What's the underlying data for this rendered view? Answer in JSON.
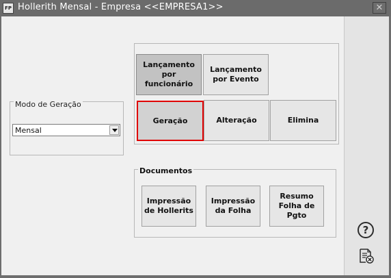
{
  "window": {
    "title": "Hollerith Mensal - Empresa <<EMPRESA1>>",
    "app_icon_text": "FP",
    "close_glyph": "✕"
  },
  "modo_geracao": {
    "legend": "Modo de Geração",
    "selected": "Mensal"
  },
  "lancamento_buttons": [
    {
      "label": "Lançamento por funcionário",
      "state": "pressed"
    },
    {
      "label": "Lançamento por Evento",
      "state": "normal"
    }
  ],
  "action_buttons": [
    {
      "label": "Geração",
      "state": "selected"
    },
    {
      "label": "Alteração",
      "state": "normal"
    },
    {
      "label": "Elimina",
      "state": "normal"
    }
  ],
  "documentos": {
    "legend": "Documentos",
    "buttons": [
      {
        "label": "Impressão de Hollerits"
      },
      {
        "label": "Impressão da Folha"
      },
      {
        "label": "Resumo Folha de Pgto"
      }
    ]
  },
  "sidebar": {
    "help_glyph": "?",
    "icons": [
      "help-icon",
      "document-close-icon"
    ]
  },
  "colors": {
    "selected_border": "#e00000",
    "titlebar": "#6b6b6b"
  }
}
